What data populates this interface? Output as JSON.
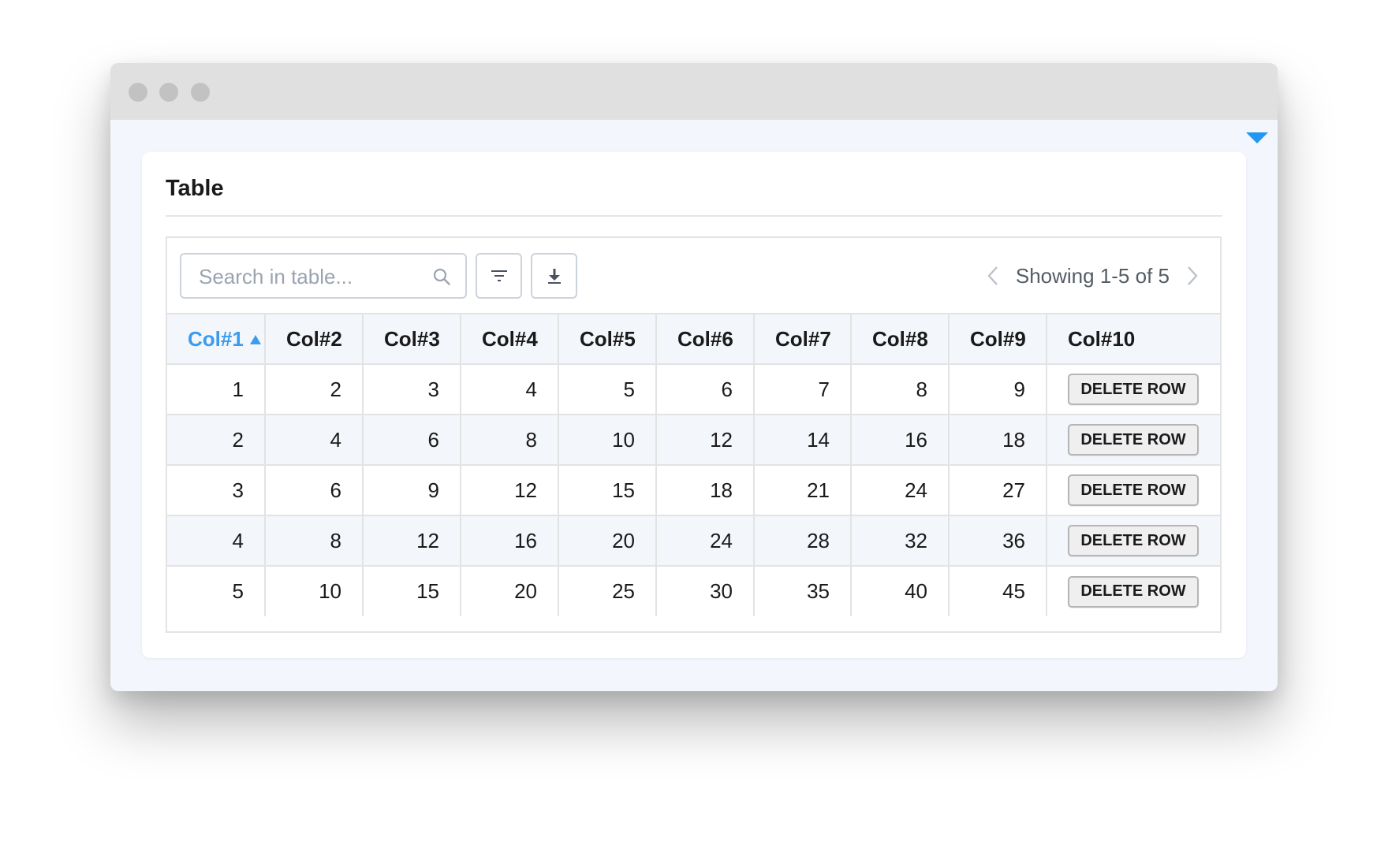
{
  "panel": {
    "title": "Table"
  },
  "toolbar": {
    "search_placeholder": "Search in table...",
    "pagination_text": "Showing 1-5 of 5"
  },
  "table": {
    "columns": [
      "Col#1",
      "Col#2",
      "Col#3",
      "Col#4",
      "Col#5",
      "Col#6",
      "Col#7",
      "Col#8",
      "Col#9",
      "Col#10"
    ],
    "sorted_column": "Col#1",
    "sort_direction": "ascending",
    "rows": [
      {
        "cells": [
          "1",
          "2",
          "3",
          "4",
          "5",
          "6",
          "7",
          "8",
          "9"
        ],
        "action": "DELETE ROW"
      },
      {
        "cells": [
          "2",
          "4",
          "6",
          "8",
          "10",
          "12",
          "14",
          "16",
          "18"
        ],
        "action": "DELETE ROW"
      },
      {
        "cells": [
          "3",
          "6",
          "9",
          "12",
          "15",
          "18",
          "21",
          "24",
          "27"
        ],
        "action": "DELETE ROW"
      },
      {
        "cells": [
          "4",
          "8",
          "12",
          "16",
          "20",
          "24",
          "28",
          "32",
          "36"
        ],
        "action": "DELETE ROW"
      },
      {
        "cells": [
          "5",
          "10",
          "15",
          "20",
          "25",
          "30",
          "35",
          "40",
          "45"
        ],
        "action": "DELETE ROW"
      }
    ]
  },
  "icons": {
    "search": "search-icon",
    "filter": "filter-icon",
    "download": "download-icon",
    "prev": "chevron-left-icon",
    "next": "chevron-right-icon",
    "sort": "sort-ascending-icon",
    "collapse": "caret-down-icon"
  },
  "colors": {
    "accent": "#3a9bf0",
    "window_bg": "#f3f6fc",
    "titlebar": "#e0e0e0",
    "alt_row": "#f3f6fa"
  }
}
